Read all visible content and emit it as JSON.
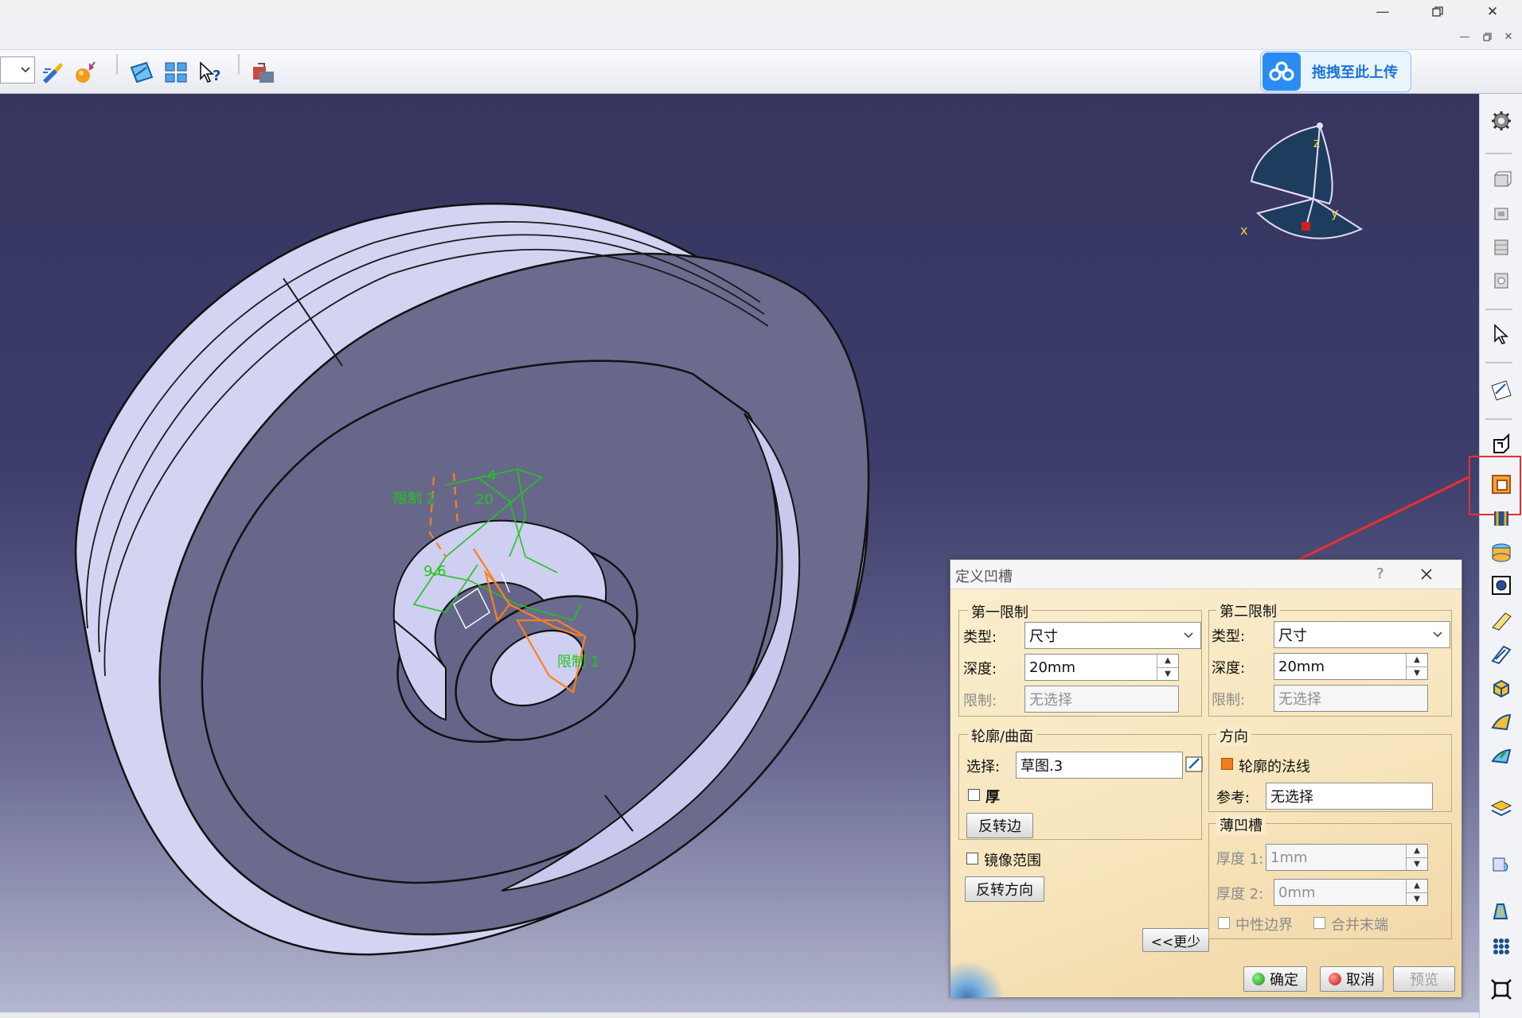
{
  "window": {
    "controls": [
      "minimize-icon",
      "restore-icon",
      "close-icon"
    ]
  },
  "toolbar": {
    "combo_value": ""
  },
  "upload_button": {
    "label": "拖拽至此上传"
  },
  "viewport": {
    "sketch_labels": {
      "limit1": "限制 1",
      "limit2": "限制 2",
      "dim_96": "9.6",
      "dim_20": "20",
      "dim_4": "4"
    },
    "compass": {
      "x": "x",
      "y": "y",
      "z": "z"
    }
  },
  "dialog": {
    "title": "定义凹槽",
    "help": "?",
    "first_limit": {
      "title": "第一限制",
      "type_label": "类型:",
      "type_value": "尺寸",
      "depth_label": "深度:",
      "depth_value": "20mm",
      "limit_label": "限制:",
      "limit_value": "无选择"
    },
    "second_limit": {
      "title": "第二限制",
      "type_label": "类型:",
      "type_value": "尺寸",
      "depth_label": "深度:",
      "depth_value": "20mm",
      "limit_label": "限制:",
      "limit_value": "无选择"
    },
    "profile": {
      "title": "轮廓/曲面",
      "select_label": "选择:",
      "select_value": "草图.3",
      "thick_label": "厚",
      "thick_checked": false,
      "reverse_side_label": "反转边"
    },
    "mirrored_label": "镜像范围",
    "mirrored_checked": false,
    "reverse_dir_label": "反转方向",
    "less_label": "<<更少",
    "direction": {
      "title": "方向",
      "normal_label": "轮廓的法线",
      "normal_checked": true,
      "ref_label": "参考:",
      "ref_value": "无选择"
    },
    "thin": {
      "title": "薄凹槽",
      "thick1_label": "厚度 1:",
      "thick1_value": "1mm",
      "thick2_label": "厚度 2:",
      "thick2_value": "0mm",
      "neutral_label": "中性边界",
      "merge_label": "合并末端"
    },
    "ok_label": "确定",
    "cancel_label": "取消",
    "preview_label": "预览"
  },
  "colors": {
    "accent_highlight": "#e03232",
    "viewport_top": "#35355f",
    "part_face": "#b9b9e6",
    "sketch_green": "#22c41f",
    "sketch_orange": "#ff7f1a"
  }
}
